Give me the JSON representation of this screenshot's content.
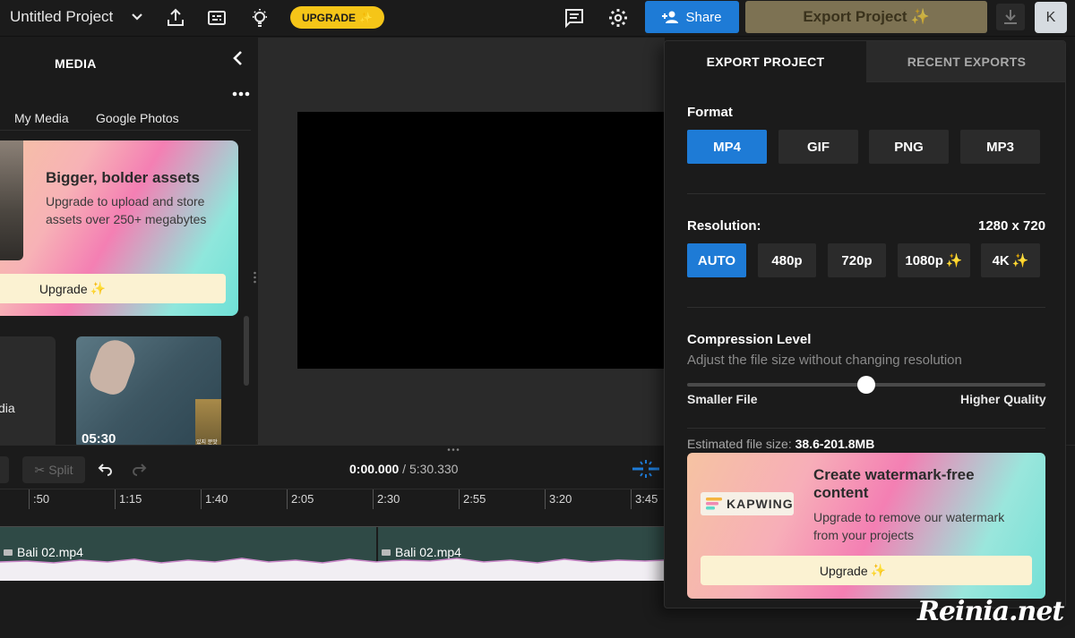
{
  "topbar": {
    "project_title": "Untitled Project",
    "upgrade_label": "UPGRADE",
    "upgrade_sparkle": "✨",
    "share_label": "Share",
    "export_label": "Export Project",
    "export_sparkle": "✨",
    "avatar_initial": "K"
  },
  "media": {
    "title": "MEDIA",
    "tabs": [
      "My Media",
      "Google Photos"
    ],
    "promo": {
      "title": "Bigger, bolder assets",
      "text": "Upgrade to upload and store assets over 250+ megabytes",
      "button": "Upgrade",
      "sparkle": "✨"
    },
    "card1_label": "dia",
    "card2_duration": "05:30",
    "card2_mini_label": "있지 분맛"
  },
  "timeline": {
    "split_label": "Split",
    "current_time": "0:00.000",
    "separator": " / ",
    "total_time": "5:30.330",
    "ticks": [
      ":50",
      "1:15",
      "1:40",
      "2:05",
      "2:30",
      "2:55",
      "3:20",
      "3:45"
    ],
    "clips": [
      "Bali 02.mp4",
      "Bali 02.mp4"
    ]
  },
  "export": {
    "tabs": {
      "active": "EXPORT PROJECT",
      "inactive": "RECENT EXPORTS"
    },
    "format": {
      "label": "Format",
      "options": [
        "MP4",
        "GIF",
        "PNG",
        "MP3"
      ],
      "selected": "MP4"
    },
    "resolution": {
      "label": "Resolution:",
      "value": "1280 x 720",
      "options": [
        "AUTO",
        "480p",
        "720p",
        "1080p",
        "4K"
      ],
      "selected": "AUTO",
      "premium_sparkle": "✨"
    },
    "compression": {
      "label": "Compression Level",
      "subtitle": "Adjust the file size without changing resolution",
      "min_label": "Smaller File",
      "max_label": "Higher Quality",
      "level": 0.5
    },
    "estimate": {
      "label": "Estimated file size:",
      "value": "38.6-201.8MB"
    },
    "watermark_promo": {
      "logo_text": "KAPWING",
      "title": "Create watermark-free content",
      "text": "Upgrade to remove our watermark from your projects",
      "button": "Upgrade",
      "sparkle": "✨"
    }
  },
  "overlay": {
    "site_watermark": "Reinia.net"
  },
  "colors": {
    "accent_blue": "#1e7bd6",
    "upgrade_yellow": "#f5c518",
    "background": "#1b1b1b",
    "clip_green": "#2f4a46"
  }
}
